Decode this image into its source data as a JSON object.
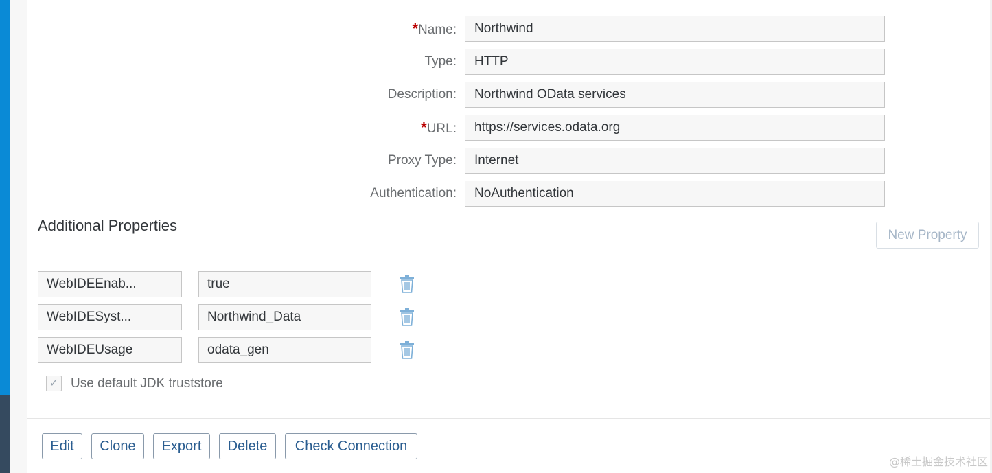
{
  "form": {
    "name_label": "Name:",
    "name_value": "Northwind",
    "type_label": "Type:",
    "type_value": "HTTP",
    "description_label": "Description:",
    "description_value": "Northwind OData services",
    "url_label": "URL:",
    "url_value": "https://services.odata.org",
    "proxy_label": "Proxy Type:",
    "proxy_value": "Internet",
    "auth_label": "Authentication:",
    "auth_value": "NoAuthentication",
    "required_marker": "*"
  },
  "additional": {
    "title": "Additional Properties",
    "new_property_label": "New Property",
    "properties": [
      {
        "key": "WebIDEEnab...",
        "value": "true"
      },
      {
        "key": "WebIDESyst...",
        "value": "Northwind_Data"
      },
      {
        "key": "WebIDEUsage",
        "value": "odata_gen"
      }
    ],
    "trash_icon": "trash-icon"
  },
  "truststore": {
    "label": "Use default JDK truststore",
    "checked": true,
    "check_glyph": "✓"
  },
  "actions": {
    "edit": "Edit",
    "clone": "Clone",
    "export": "Export",
    "delete": "Delete",
    "check": "Check Connection"
  },
  "watermark": "@稀土掘金技术社区",
  "colors": {
    "accent": "#0a8ad6",
    "shell_dark": "#354a5f",
    "required": "#bb0000",
    "button_text": "#2a5d90",
    "trash": "#7eb0d8"
  }
}
